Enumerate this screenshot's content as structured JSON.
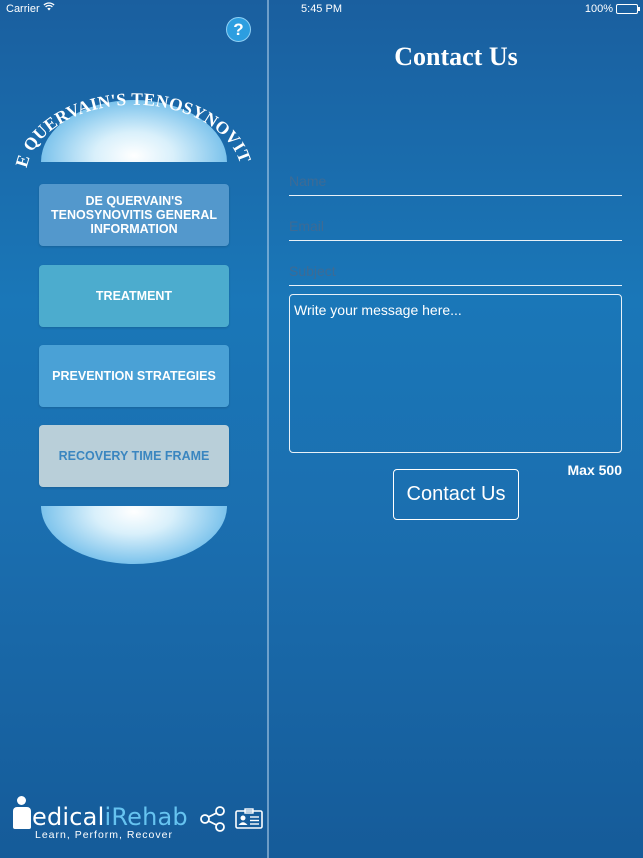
{
  "status_bar": {
    "carrier": "Carrier",
    "time": "5:45 PM",
    "battery": "100%"
  },
  "sidebar": {
    "help_label": "?",
    "logo_title": "DE QUERVAIN'S TENOSYNOVITIS",
    "menu": [
      {
        "label": "DE QUERVAIN'S TENOSYNOVITIS GENERAL INFORMATION"
      },
      {
        "label": "TREATMENT"
      },
      {
        "label": "PREVENTION STRATEGIES"
      },
      {
        "label": "RECOVERY TIME FRAME"
      }
    ],
    "brand": {
      "name_part1": "edical",
      "name_part2": "iRehab",
      "tagline": "Learn, Perform, Recover"
    },
    "icons": [
      "share-icon",
      "contact-card-icon"
    ]
  },
  "contact": {
    "title": "Contact Us",
    "name_placeholder": "Name",
    "email_placeholder": "Email",
    "subject_placeholder": "Subject",
    "message_placeholder": "Write your message here...",
    "max_label": "Max 500",
    "submit_label": "Contact Us"
  },
  "colors": {
    "background": "#1a77b8",
    "btn_general": "#5398cc",
    "btn_treatment": "#4cacce",
    "btn_prevention": "#4aa1d6",
    "btn_recovery": "#b9cfd9",
    "brand_accent": "#66c3f0"
  }
}
